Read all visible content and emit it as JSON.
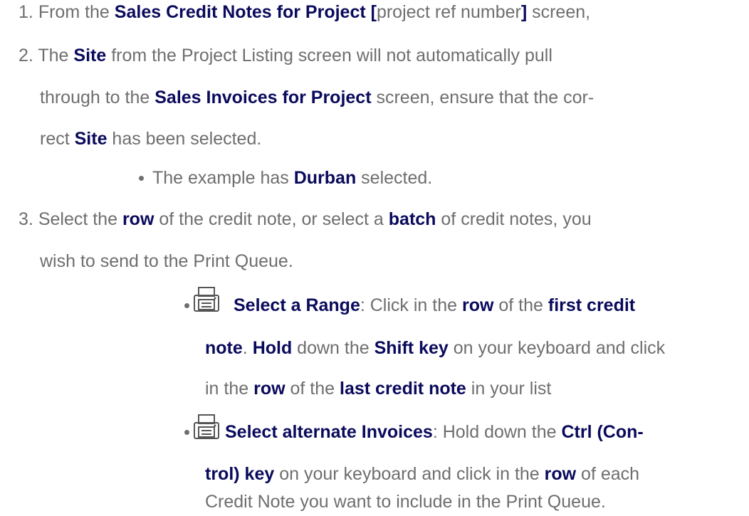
{
  "steps": [
    {
      "num": "1.",
      "line1": {
        "a": "From the ",
        "b1": "Sales Credit Notes for Project [",
        "c": "project ref number",
        "b2": "]",
        "d": " screen,"
      }
    },
    {
      "num": "2.",
      "line1": {
        "a": "The ",
        "b1": "Site",
        "c": " from the Project Listing screen will not automatically pull"
      },
      "line2": {
        "a": "through to the ",
        "b1": "Sales Invoices for Project",
        "c": " screen, ensure that the cor-"
      },
      "line3": {
        "a": "rect ",
        "b1": "Site",
        "c": " has been selected."
      },
      "bullet": {
        "a": "The example has ",
        "b1": "Durban",
        "c": " selected."
      }
    },
    {
      "num": "3.",
      "line1": {
        "a": "Select the ",
        "b1": "row",
        "c": " of the credit note, or select a ",
        "b2": "batch",
        "d": " of credit notes, you"
      },
      "line2": {
        "a": "wish to send to the Print Queue."
      },
      "bullets": [
        {
          "icon": "printer-icon",
          "line1": {
            "b1": "Select a Range",
            "a": ": Click in the ",
            "b2": "row",
            "c": " of the ",
            "b3": "first credit"
          },
          "line2": {
            "b1": "note",
            "a": ". ",
            "b2": "Hold",
            "c": " down the  ",
            "b3": "Shift key",
            "d": " on your keyboard and click"
          },
          "line3": {
            "a": "in the ",
            "b1": "row",
            "c": " of the ",
            "b2": "last credit note",
            "d": " in your list"
          }
        },
        {
          "icon": "printer-icon",
          "line1": {
            "b1": "Select alternate Invoices",
            "a": ": Hold down the  ",
            "b2": "Ctrl (Con-"
          },
          "line2": {
            "b1": "trol) key",
            "a": " on your keyboard and click in the  ",
            "b2": "row",
            "c": " of each"
          },
          "line3": {
            "a": "Credit Note you want to include in the Print Queue."
          }
        }
      ]
    }
  ]
}
